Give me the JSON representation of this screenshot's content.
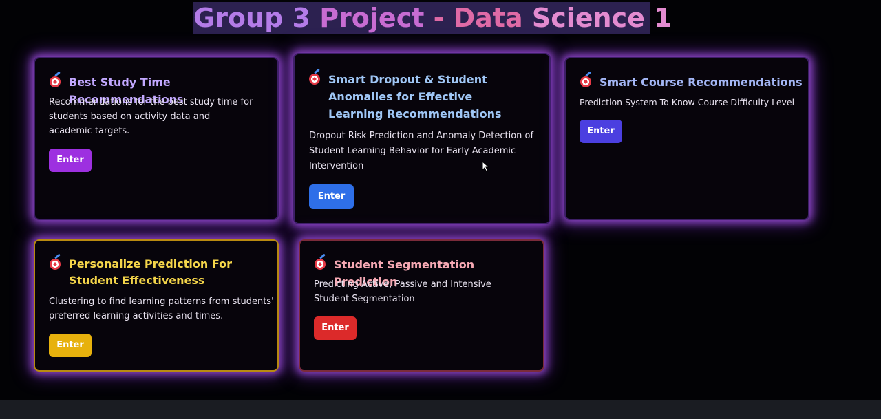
{
  "page": {
    "title": "Group 3 Project - Data Science 1",
    "title_words": [
      "Group 3",
      "Project",
      "- Data",
      "Science 1"
    ]
  },
  "cards": [
    {
      "title": "Best Study Time Recommendations",
      "description": "Recommendations for the best study time for students based on activity data and academic targets.",
      "button_label": "Enter",
      "title_color": "#c2a8ff",
      "button_color": "#9d30e0",
      "icon": "target-icon"
    },
    {
      "title": "Smart Dropout & Student Anomalies for Effective Learning Recommendations",
      "description": "Dropout Risk Prediction and Anomaly Detection of Student Learning Behavior for Early Academic Intervention",
      "button_label": "Enter",
      "title_color": "#9fc6f5",
      "button_color": "#2e6fe8",
      "icon": "target-icon"
    },
    {
      "title": "Smart Course Recommendations",
      "description": "Prediction System To Know Course Difficulty Level",
      "button_label": "Enter",
      "title_color": "#a3b6f5",
      "button_color": "#4b3fe0",
      "icon": "target-icon"
    },
    {
      "title": "Personalize Prediction For Student Effectiveness",
      "description": "Clustering to find learning patterns from students' preferred learning activities and times.",
      "button_label": "Enter",
      "title_color": "#f4d54a",
      "button_color": "#e7b10d",
      "icon": "target-icon"
    },
    {
      "title": "Student Segmentation Prediction",
      "description": "Predicting Active, Passive and Intensive Student Segmentation",
      "button_label": "Enter",
      "title_color": "#f5a8b3",
      "button_color": "#dc2a2a",
      "icon": "target-icon"
    }
  ]
}
